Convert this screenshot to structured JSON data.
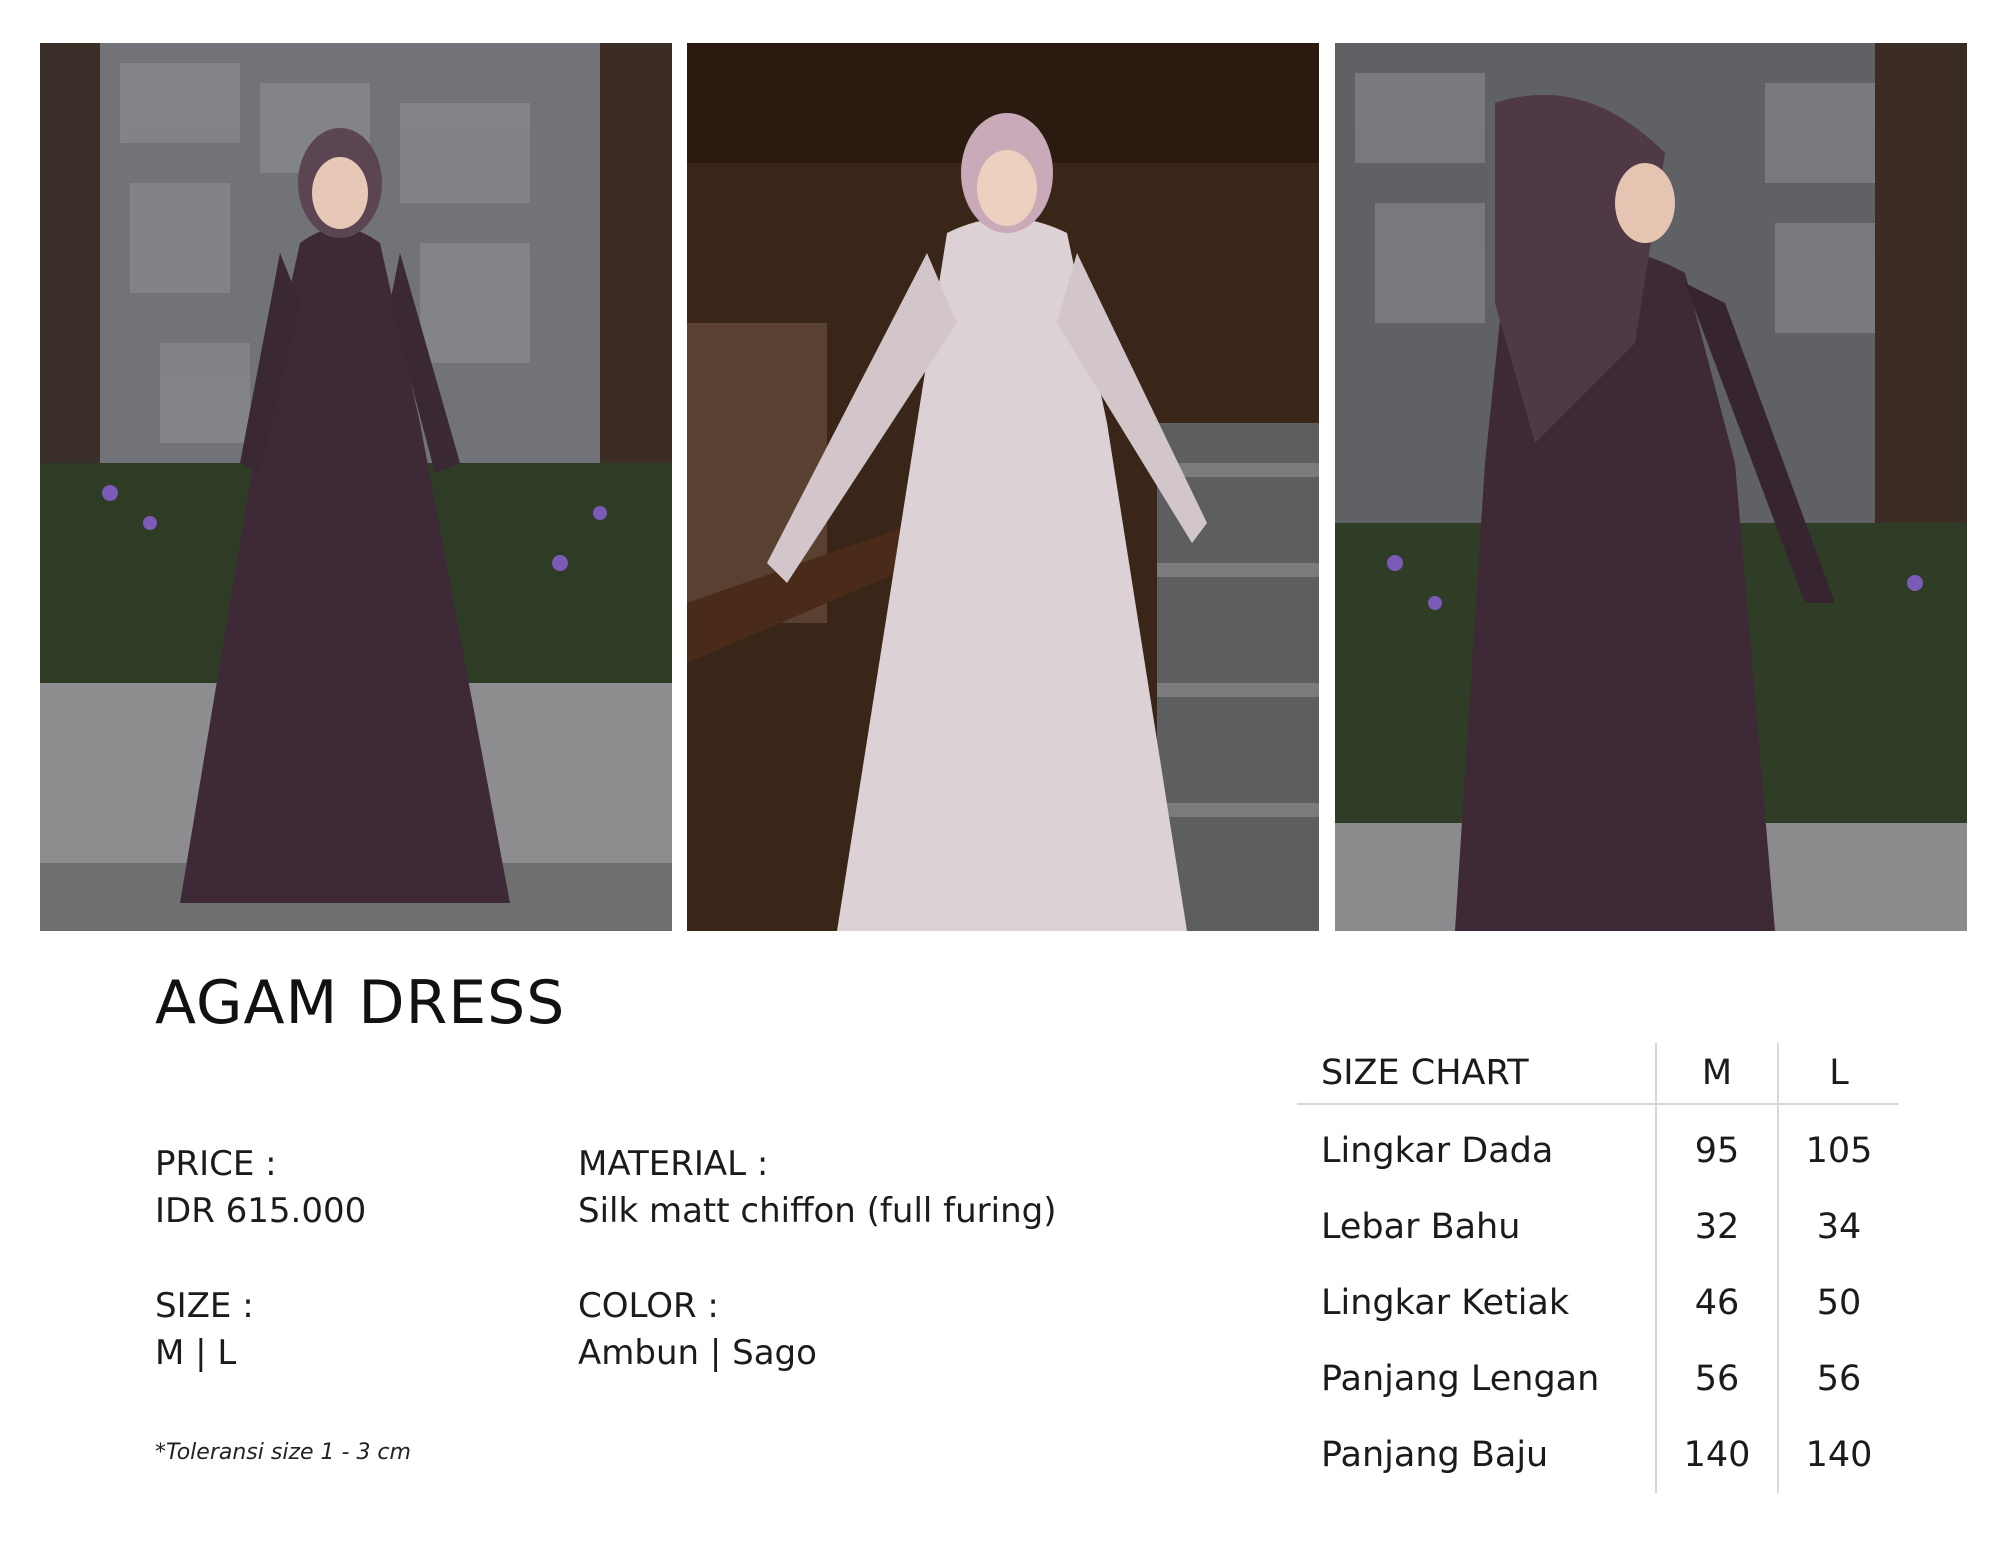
{
  "product": {
    "title": "AGAM DRESS",
    "price_label": "PRICE :",
    "price_value": "IDR 615.000",
    "material_label": "MATERIAL :",
    "material_value": "Silk matt chiffon (full furing)",
    "size_label": "SIZE :",
    "size_value": "M | L",
    "color_label": "COLOR :",
    "color_value": "Ambun | Sago",
    "note": "*Toleransi size 1 - 3 cm"
  },
  "size_chart": {
    "header": [
      "SIZE CHART",
      "M",
      "L"
    ],
    "rows": [
      [
        "Lingkar Dada",
        "95",
        "105"
      ],
      [
        "Lebar Bahu",
        "32",
        "34"
      ],
      [
        "Lingkar Ketiak",
        "46",
        "50"
      ],
      [
        "Panjang Lengan",
        "56",
        "56"
      ],
      [
        "Panjang Baju",
        "140",
        "140"
      ]
    ]
  },
  "colors": {
    "sago": "#3e2a36",
    "ambun": "#dcd2d6",
    "stone": "#6e6e70"
  }
}
